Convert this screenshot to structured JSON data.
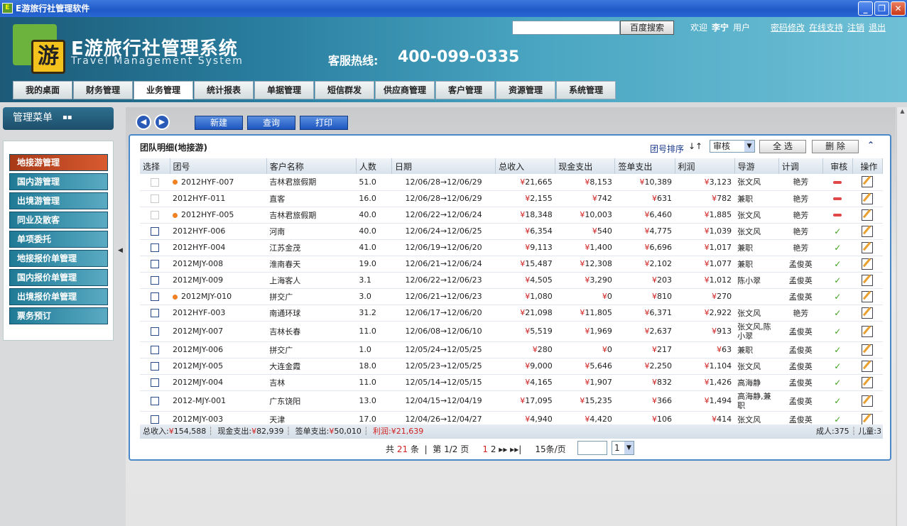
{
  "window": {
    "title": "E游旅行社管理软件",
    "icon": "app-icon"
  },
  "header": {
    "logo_char": "游",
    "system_name": "E游旅行社管理系统",
    "system_name_en": "Travel Management System",
    "hotline_label": "客服热线:",
    "hotline_number": "400-099-0335",
    "search_button": "百度搜索",
    "welcome": "欢迎",
    "user_name": "李宁",
    "user_role": "用户",
    "links": [
      "密码修改",
      "在线支持",
      "注销",
      "退出"
    ]
  },
  "nav": {
    "tabs": [
      "我的桌面",
      "财务管理",
      "业务管理",
      "统计报表",
      "单据管理",
      "短信群发",
      "供应商管理",
      "客户管理",
      "资源管理",
      "系统管理"
    ],
    "active": "业务管理"
  },
  "sidebar": {
    "title": "管理菜单",
    "items": [
      "地接游管理",
      "国内游管理",
      "出境游管理",
      "同业及散客",
      "单项委托",
      "地接报价单管理",
      "国内报价单管理",
      "出境报价单管理",
      "票务预订"
    ],
    "active": "地接游管理"
  },
  "toolbar": {
    "new": "新建",
    "query": "查询",
    "print": "打印"
  },
  "panel": {
    "title": "团队明细(地接游)",
    "sort_label": "团号排序",
    "audit_select": "审核",
    "select_all": "全 选",
    "delete": "删 除"
  },
  "table": {
    "columns": [
      "选择",
      "团号",
      "客户名称",
      "人数",
      "日期",
      "总收入",
      "现金支出",
      "签单支出",
      "利润",
      "导游",
      "计调",
      "审核",
      "操作"
    ],
    "rows": [
      {
        "id": "2012HYF-007",
        "client": "吉林君旅假期",
        "people": "51.0",
        "date": "12/06/28→12/06/29",
        "income": "21,665",
        "cash": "8,153",
        "sign": "10,389",
        "profit": "3,123",
        "guide": "张文风",
        "planner": "艳芳",
        "audit": "no",
        "dot": true,
        "dim": true
      },
      {
        "id": "2012HYF-011",
        "client": "直客",
        "people": "16.0",
        "date": "12/06/28→12/06/29",
        "income": "2,155",
        "cash": "742",
        "sign": "631",
        "profit": "782",
        "guide": "兼职",
        "planner": "艳芳",
        "audit": "no",
        "dot": false,
        "dim": true
      },
      {
        "id": "2012HYF-005",
        "client": "吉林君旅假期",
        "people": "40.0",
        "date": "12/06/22→12/06/24",
        "income": "18,348",
        "cash": "10,003",
        "sign": "6,460",
        "profit": "1,885",
        "guide": "张文风",
        "planner": "艳芳",
        "audit": "no",
        "dot": true,
        "dim": true
      },
      {
        "id": "2012HYF-006",
        "client": "河南",
        "people": "40.0",
        "date": "12/06/24→12/06/25",
        "income": "6,354",
        "cash": "540",
        "sign": "4,775",
        "profit": "1,039",
        "guide": "张文风",
        "planner": "艳芳",
        "audit": "yes",
        "dot": false,
        "dim": false
      },
      {
        "id": "2012HYF-004",
        "client": "江苏金茂",
        "people": "41.0",
        "date": "12/06/19→12/06/20",
        "income": "9,113",
        "cash": "1,400",
        "sign": "6,696",
        "profit": "1,017",
        "guide": "兼职",
        "planner": "艳芳",
        "audit": "yes",
        "dot": false,
        "dim": false
      },
      {
        "id": "2012MJY-008",
        "client": "淮南春天",
        "people": "19.0",
        "date": "12/06/21→12/06/24",
        "income": "15,487",
        "cash": "12,308",
        "sign": "2,102",
        "profit": "1,077",
        "guide": "兼职",
        "planner": "孟俊英",
        "audit": "yes",
        "dot": false,
        "dim": false
      },
      {
        "id": "2012MJY-009",
        "client": "上海客人",
        "people": "3.1",
        "date": "12/06/22→12/06/23",
        "income": "4,505",
        "cash": "3,290",
        "sign": "203",
        "profit": "1,012",
        "guide": "陈小翠",
        "planner": "孟俊英",
        "audit": "yes",
        "dot": false,
        "dim": false
      },
      {
        "id": "2012MJY-010",
        "client": "拼交广",
        "people": "3.0",
        "date": "12/06/21→12/06/23",
        "income": "1,080",
        "cash": "0",
        "sign": "810",
        "profit": "270",
        "guide": "",
        "planner": "孟俊英",
        "audit": "yes",
        "dot": true,
        "dim": false
      },
      {
        "id": "2012HYF-003",
        "client": "南通环球",
        "people": "31.2",
        "date": "12/06/17→12/06/20",
        "income": "21,098",
        "cash": "11,805",
        "sign": "6,371",
        "profit": "2,922",
        "guide": "张文风",
        "planner": "艳芳",
        "audit": "yes",
        "dot": false,
        "dim": false
      },
      {
        "id": "2012MJY-007",
        "client": "吉林长春",
        "people": "11.0",
        "date": "12/06/08→12/06/10",
        "income": "5,519",
        "cash": "1,969",
        "sign": "2,637",
        "profit": "913",
        "guide": "张文风,陈小翠",
        "planner": "孟俊英",
        "audit": "yes",
        "dot": false,
        "dim": false
      },
      {
        "id": "2012MJY-006",
        "client": "拼交广",
        "people": "1.0",
        "date": "12/05/24→12/05/25",
        "income": "280",
        "cash": "0",
        "sign": "217",
        "profit": "63",
        "guide": "兼职",
        "planner": "孟俊英",
        "audit": "yes",
        "dot": false,
        "dim": false
      },
      {
        "id": "2012MJY-005",
        "client": "大连金霞",
        "people": "18.0",
        "date": "12/05/23→12/05/25",
        "income": "9,000",
        "cash": "5,646",
        "sign": "2,250",
        "profit": "1,104",
        "guide": "张文风",
        "planner": "孟俊英",
        "audit": "yes",
        "dot": false,
        "dim": false
      },
      {
        "id": "2012MJY-004",
        "client": "吉林",
        "people": "11.0",
        "date": "12/05/14→12/05/15",
        "income": "4,165",
        "cash": "1,907",
        "sign": "832",
        "profit": "1,426",
        "guide": "高海静",
        "planner": "孟俊英",
        "audit": "yes",
        "dot": false,
        "dim": false
      },
      {
        "id": "2012-MJY-001",
        "client": "广东饶阳",
        "people": "13.0",
        "date": "12/04/15→12/04/19",
        "income": "17,095",
        "cash": "15,235",
        "sign": "366",
        "profit": "1,494",
        "guide": "高海静,兼职",
        "planner": "孟俊英",
        "audit": "yes",
        "dot": false,
        "dim": false
      },
      {
        "id": "2012MJY-003",
        "client": "天津",
        "people": "17.0",
        "date": "12/04/26→12/04/27",
        "income": "4,940",
        "cash": "4,420",
        "sign": "106",
        "profit": "414",
        "guide": "张文风",
        "planner": "孟俊英",
        "audit": "yes",
        "dot": false,
        "dim": false
      }
    ]
  },
  "totals": {
    "income_label": "总收入:",
    "income": "154,588",
    "cash_label": "现金支出:",
    "cash": "82,939",
    "sign_label": "签单支出:",
    "sign": "50,010",
    "profit_label": "利润:",
    "profit": "21,639",
    "adults": "成人:375",
    "children": "儿童:3"
  },
  "pager": {
    "total_prefix": "共",
    "total_count": "21",
    "total_suffix": "条",
    "page_prefix": "第",
    "page_value": "1/2",
    "page_suffix": "页",
    "pages": [
      "1",
      "2"
    ],
    "current": "1",
    "page_size": "15条/页",
    "goto_select": "1"
  },
  "yen": "¥",
  "colors": {
    "accent": "#2a5ab8",
    "active_side": "#c84a20",
    "header": "#2a7fa0"
  }
}
